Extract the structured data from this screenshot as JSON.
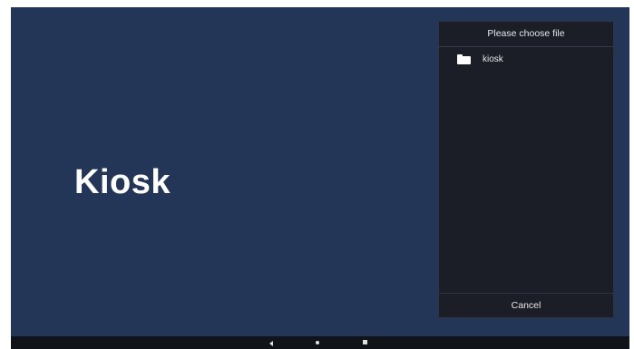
{
  "app": {
    "title": "Kiosk"
  },
  "file_dialog": {
    "header": "Please choose file",
    "items": [
      {
        "label": "kiosk",
        "icon": "folder-icon"
      }
    ],
    "cancel_label": "Cancel"
  },
  "nav_bar": {
    "buttons": [
      "back-icon",
      "home-icon",
      "recents-icon"
    ]
  },
  "colors": {
    "background": "#243658",
    "dialog": "#1c1e27",
    "navbar": "#101317",
    "text": "#ffffff"
  }
}
